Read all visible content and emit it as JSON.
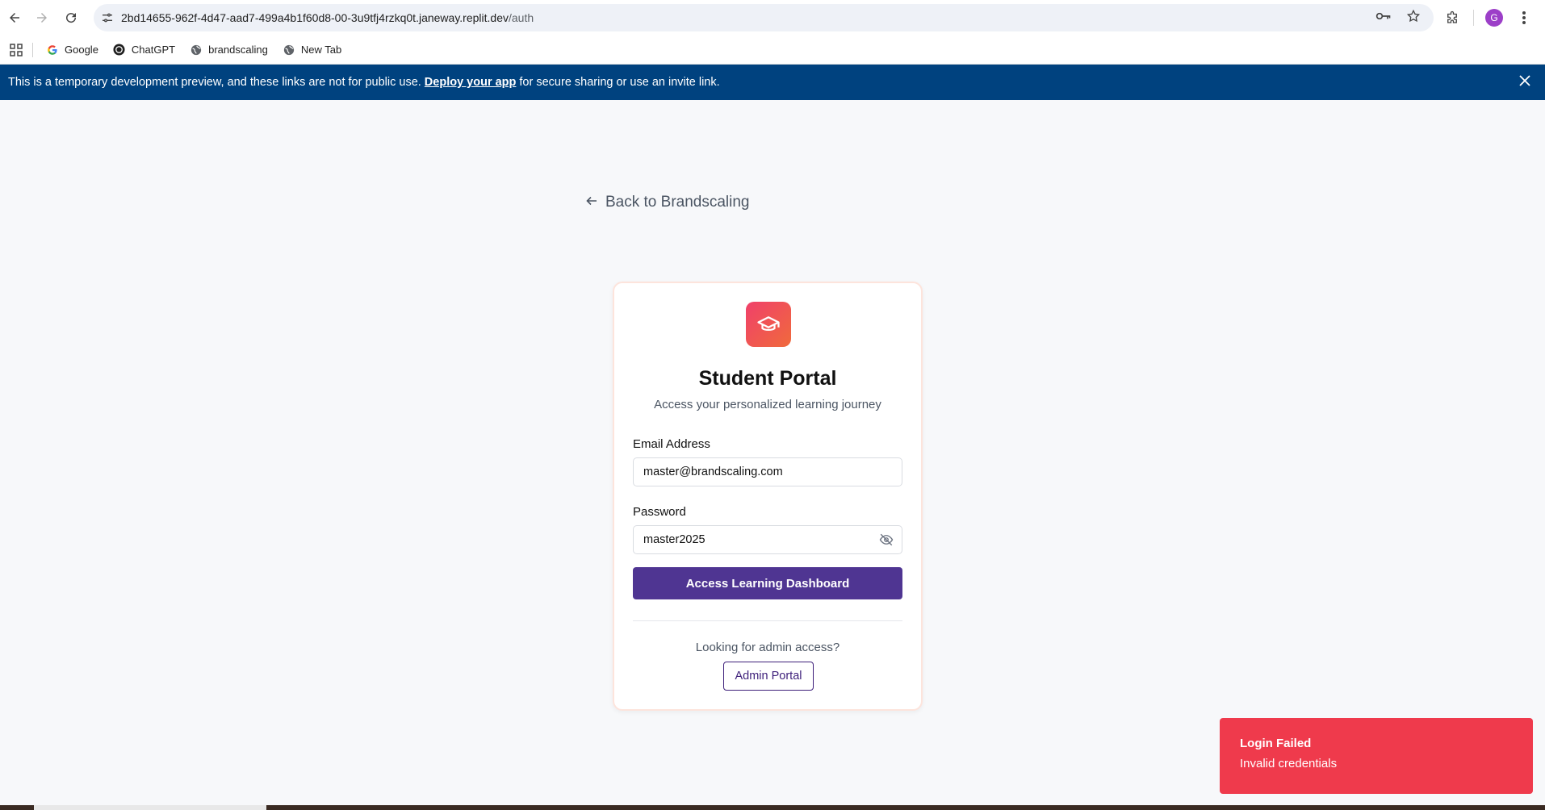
{
  "browser": {
    "url_host": "2bd14655-962f-4d47-aad7-499a4b1f60d8-00-3u9tfj4rzkq0t.janeway.replit.dev",
    "url_path": "/auth",
    "avatar_letter": "G",
    "icons": [
      "back-arrow-icon",
      "forward-arrow-icon",
      "reload-icon",
      "site-settings-icon",
      "password-key-icon",
      "bookmark-star-icon",
      "extensions-icon",
      "menu-dots-icon"
    ]
  },
  "bookmarks": [
    {
      "label": "Google",
      "icon": "google-icon"
    },
    {
      "label": "ChatGPT",
      "icon": "chatgpt-icon"
    },
    {
      "label": "brandscaling",
      "icon": "globe-icon"
    },
    {
      "label": "New Tab",
      "icon": "globe-icon"
    }
  ],
  "banner": {
    "text_before": "This is a temporary development preview, and these links are not for public use.",
    "link": "Deploy your app",
    "text_after": "for secure sharing or use an invite link."
  },
  "page": {
    "back_link": "Back to Brandscaling",
    "card": {
      "title": "Student Portal",
      "subtitle": "Access your personalized learning journey",
      "email_label": "Email Address",
      "email_value": "master@brandscaling.com",
      "password_label": "Password",
      "password_value": "master2025",
      "submit_label": "Access Learning Dashboard",
      "admin_question": "Looking for admin access?",
      "admin_button": "Admin Portal"
    }
  },
  "toast": {
    "title": "Login Failed",
    "description": "Invalid credentials"
  },
  "colors": {
    "banner_bg": "#00427f",
    "primary": "#4f3592",
    "toast_bg": "#ef3a4c",
    "logo_gradient": [
      "#f0406a",
      "#f06a3c"
    ]
  }
}
